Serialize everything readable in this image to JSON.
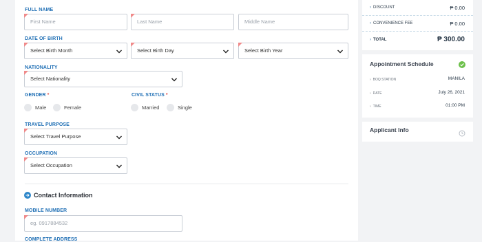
{
  "personal": {
    "full_name_label": "FULL NAME",
    "first_name_placeholder": "First Name",
    "last_name_placeholder": "Last Name",
    "middle_name_placeholder": "Middle Name",
    "dob_label": "DATE OF BIRTH",
    "birth_month": "Select Birth Month",
    "birth_day": "Select Birth Day",
    "birth_year": "Select Birth Year",
    "nationality_label": "NATIONALITY",
    "nationality": "Select Nationality",
    "gender_label": "GENDER",
    "gender_options": [
      "Male",
      "Female"
    ],
    "civil_status_label": "CIVIL STATUS",
    "civil_status_options": [
      "Married",
      "Single"
    ],
    "required_mark": "*",
    "travel_purpose_label": "TRAVEL PURPOSE",
    "travel_purpose": "Select Travel Purpose",
    "occupation_label": "OCCUPATION",
    "occupation": "Select Occupation"
  },
  "contact": {
    "section_title": "Contact Information",
    "mobile_label": "MOBILE NUMBER",
    "mobile_placeholder": "eg. 0917884532",
    "address_label": "COMPLETE ADDRESS"
  },
  "summary": {
    "rows": [
      {
        "label": "DISCOUNT",
        "value": "₱ 0.00"
      },
      {
        "label": "CONVENIENCE FEE",
        "value": "₱ 0.00"
      },
      {
        "label": "TOTAL",
        "value": "₱ 300.00"
      }
    ],
    "row_arrow": "›"
  },
  "schedule": {
    "title": "Appointment Schedule",
    "rows": [
      {
        "label": "BOQ STATION",
        "value": "MANILA"
      },
      {
        "label": "DATE",
        "value": "July 26, 2021"
      },
      {
        "label": "TIME",
        "value": "01:00 PM"
      }
    ],
    "status_color": "#6cc04a"
  },
  "applicant": {
    "title": "Applicant Info"
  },
  "colors": {
    "accent": "#1f6fb5",
    "required": "#e0534b",
    "flag": "#f08a8a"
  }
}
